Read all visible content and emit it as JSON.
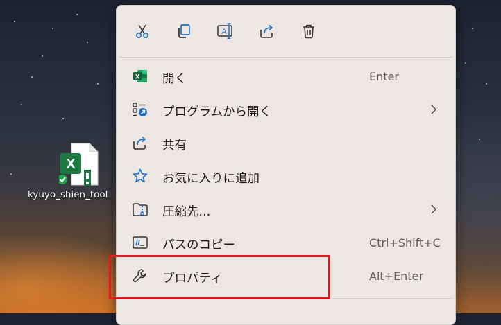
{
  "desktop": {
    "file_label": "kyuyo_shien_tool",
    "file_icon": "excel-file-icon",
    "status_badge": "sync-ok-icon"
  },
  "context_menu": {
    "toolbar": [
      {
        "name": "cut",
        "icon": "scissors-icon"
      },
      {
        "name": "copy",
        "icon": "copy-icon"
      },
      {
        "name": "rename",
        "icon": "rename-icon"
      },
      {
        "name": "share",
        "icon": "share-icon"
      },
      {
        "name": "delete",
        "icon": "trash-icon"
      }
    ],
    "items": [
      {
        "label": "開く",
        "shortcut": "Enter",
        "icon": "excel-icon"
      },
      {
        "label": "プログラムから開く",
        "shortcut": "",
        "icon": "open-with-icon",
        "submenu": true
      },
      {
        "label": "共有",
        "shortcut": "",
        "icon": "share-icon"
      },
      {
        "label": "お気に入りに追加",
        "shortcut": "",
        "icon": "star-icon"
      },
      {
        "label": "圧縮先...",
        "shortcut": "",
        "icon": "zip-folder-icon",
        "submenu": true
      },
      {
        "label": "パスのコピー",
        "shortcut": "Ctrl+Shift+C",
        "icon": "copy-path-icon"
      },
      {
        "label": "プロパティ",
        "shortcut": "Alt+Enter",
        "icon": "wrench-icon"
      }
    ]
  },
  "colors": {
    "accent_blue": "#1f6fc4",
    "excel_green": "#1d7a45",
    "highlight_red": "#e8141b"
  }
}
